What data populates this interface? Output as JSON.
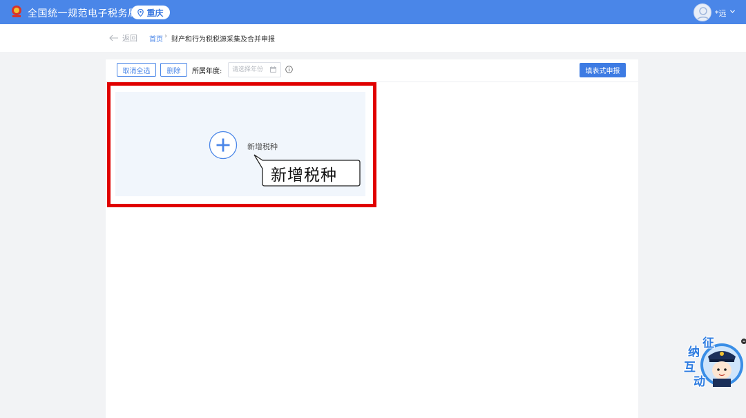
{
  "header": {
    "site_title": "全国统一规范电子税务局",
    "city": "重庆",
    "user_name": "*远"
  },
  "breadcrumb": {
    "back": "返回",
    "home": "首页",
    "separator": "›",
    "current": "财产和行为税税源采集及合并申报"
  },
  "toolbar": {
    "deselect_all": "取消全选",
    "delete": "删除",
    "year_label": "所属年度:",
    "year_placeholder": "请选择年份",
    "fill_form_button": "填表式申报"
  },
  "card": {
    "add_label": "新增税种",
    "callout": "新增税种"
  },
  "mascot": {
    "chars": [
      "征",
      "纳",
      "互",
      "动"
    ]
  },
  "colors": {
    "header": "#4a86e8",
    "primary": "#3d7be3",
    "highlight": "#e00000",
    "card_bg": "#f1f6fc"
  }
}
